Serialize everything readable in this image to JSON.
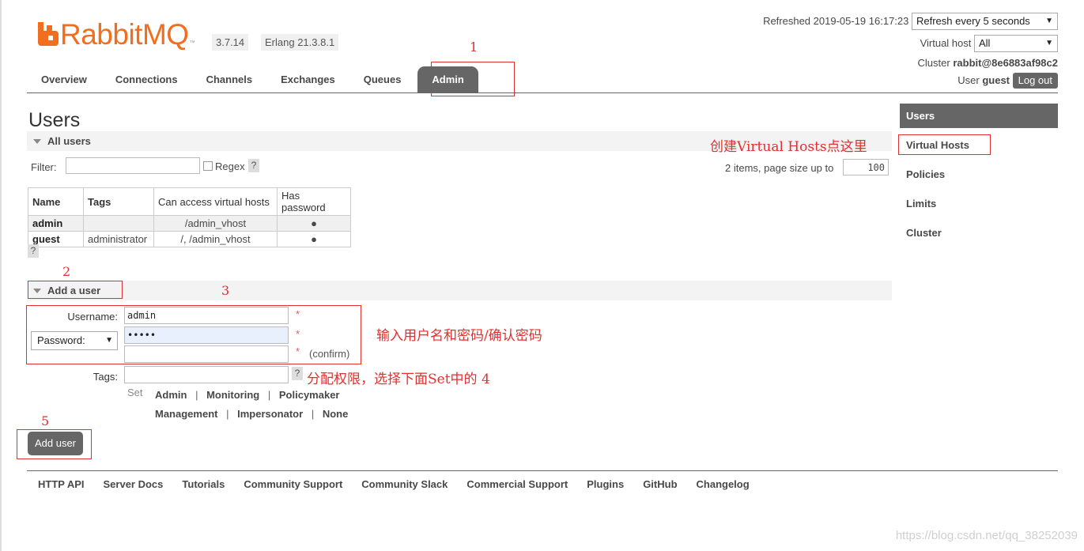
{
  "header": {
    "brand": "RabbitMQ",
    "version": "3.7.14",
    "erlang": "Erlang 21.3.8.1",
    "refreshed_label": "Refreshed 2019-05-19 16:17:23",
    "refresh_select": "Refresh every 5 seconds",
    "vhost_label": "Virtual host",
    "vhost_select": "All",
    "cluster_label": "Cluster",
    "cluster_name": "rabbit@8e6883af98c2",
    "user_label": "User",
    "user_name": "guest",
    "logout": "Log out"
  },
  "nav": {
    "tabs": [
      {
        "label": "Overview"
      },
      {
        "label": "Connections"
      },
      {
        "label": "Channels"
      },
      {
        "label": "Exchanges"
      },
      {
        "label": "Queues"
      },
      {
        "label": "Admin"
      }
    ]
  },
  "sidebar": {
    "items": [
      {
        "label": "Users"
      },
      {
        "label": "Virtual Hosts"
      },
      {
        "label": "Policies"
      },
      {
        "label": "Limits"
      },
      {
        "label": "Cluster"
      }
    ]
  },
  "page_title": "Users",
  "all_users": {
    "section_label": "All users",
    "filter_label": "Filter:",
    "filter_value": "",
    "regex_label": "Regex",
    "help": "?",
    "items_label": "2 items, page size up to",
    "page_size": "100",
    "columns": [
      "Name",
      "Tags",
      "Can access virtual hosts",
      "Has password"
    ],
    "rows": [
      {
        "name": "admin",
        "tags": "",
        "vhosts": "/admin_vhost",
        "has_password": "●"
      },
      {
        "name": "guest",
        "tags": "administrator",
        "vhosts": "/, /admin_vhost",
        "has_password": "●"
      }
    ]
  },
  "add_user": {
    "section_label": "Add a user",
    "username_label": "Username:",
    "username_value": "admin",
    "password_select": "Password:",
    "password_value": "•••••",
    "confirm_value": "",
    "required": "*",
    "confirm_label": "(confirm)",
    "tags_label": "Tags:",
    "tags_value": "",
    "set_label": "Set",
    "tag_options": [
      "Admin",
      "Monitoring",
      "Policymaker",
      "Management",
      "Impersonator",
      "None"
    ],
    "separator": "|",
    "submit": "Add user"
  },
  "footer": {
    "links": [
      "HTTP API",
      "Server Docs",
      "Tutorials",
      "Community Support",
      "Community Slack",
      "Commercial Support",
      "Plugins",
      "GitHub",
      "Changelog"
    ]
  },
  "annotations": {
    "n1": "1",
    "n2": "2",
    "n3": "3",
    "n5": "5",
    "vhost_hint": "创建Virtual Hosts点这里",
    "password_hint": "输入用户名和密码/确认密码",
    "tags_hint": "分配权限，选择下面Set中的 4"
  },
  "watermark": "https://blog.csdn.net/qq_38252039",
  "colors": {
    "brand": "#f06e1e",
    "accent": "#666666",
    "annotation": "#e03030"
  }
}
